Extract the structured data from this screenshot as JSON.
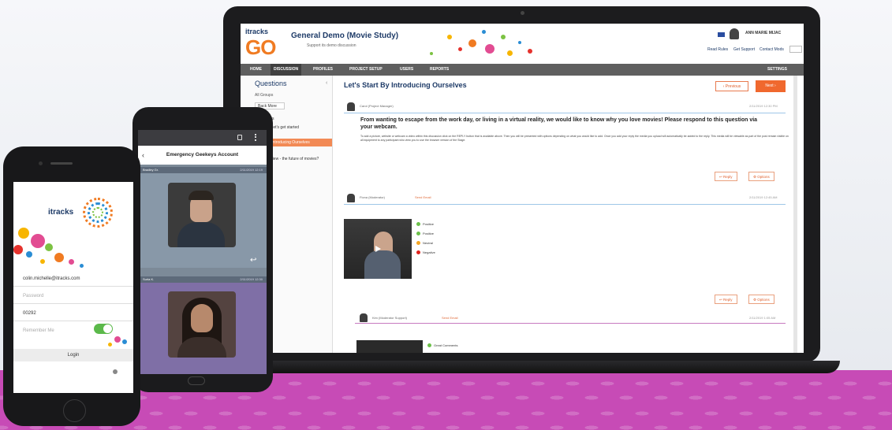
{
  "desktop": {
    "brand_top": "itracks",
    "brand_main": "GO",
    "study_title": "General Demo (Movie Study)",
    "study_subtitle": "Support its demo discussion",
    "user_name": "ANN MARIE MIJAC",
    "header_links": [
      "Read Rules",
      "Get Support",
      "Contact Mods"
    ],
    "nav": {
      "items": [
        "HOME",
        "DISCUSSION",
        "PROFILES",
        "PROJECT SETUP",
        "USERS",
        "REPORTS"
      ],
      "active": "DISCUSSION",
      "settings": "SETTINGS"
    },
    "sidebar": {
      "title": "Questions",
      "group": "All Groups",
      "button": "Back More",
      "items": [
        "Questions",
        "Hi there, let's get started",
        "Start By Introducing Ourselves",
        "Let's Review - the future of movies?"
      ],
      "active_index": 2
    },
    "content": {
      "title": "Let's Start By Introducing Ourselves",
      "prev_label": "‹ Previous",
      "next_label": "Next ›",
      "question_author": "Carol   (Project Manager)",
      "question_time": "2/11/2019 12:30 PM",
      "question_text": "From wanting to escape from the work day, or living in a virtual reality, we would like to know why you love movies! Please respond to this question via your webcam.",
      "question_body": "To add a picture, website or webcam a video within this discussion click on the REPLY button that is available above. Then you will be presented with options depending on what you would like to add. Once you add your reply the media you upload will automatically be added to the reply. This media will be viewable as part of the post remain visible on all equipment to any participant who view you to use the browser version of the Stage.",
      "reply_label": "↩ Reply",
      "options_label": "⚙ Options",
      "reply1_author": "Fiona   (Moderator)",
      "reply1_email": "Send Email",
      "reply1_time": "2/11/2019 12:45 AM",
      "sentiment_tags": [
        {
          "label": "Positive",
          "color": "#6cc04a"
        },
        {
          "label": "Positive",
          "color": "#6cc04a"
        },
        {
          "label": "Neutral",
          "color": "#f5a623"
        },
        {
          "label": "Negative",
          "color": "#e0221c"
        }
      ],
      "reply2_author": "Kim   (Moderator Support)",
      "reply2_email": "Send Email",
      "reply2_time": "2/11/2019 1:05 AM",
      "reply2_tag": "Great Comments"
    }
  },
  "mobile_mid": {
    "title": "Emergency Geekeys Account",
    "user1_name": "Bradley Gr.",
    "user1_date": "2/11/2019 12:19",
    "user2_name": "Surla K.",
    "user2_date": "2/11/2019 12:30"
  },
  "mobile_left": {
    "logo": "itracks",
    "email": "colin.michelle@itracks.com",
    "password_placeholder": "Password",
    "project_code": "00292",
    "remember_label": "Remember Me",
    "remember_on": true,
    "login_label": "Login"
  }
}
